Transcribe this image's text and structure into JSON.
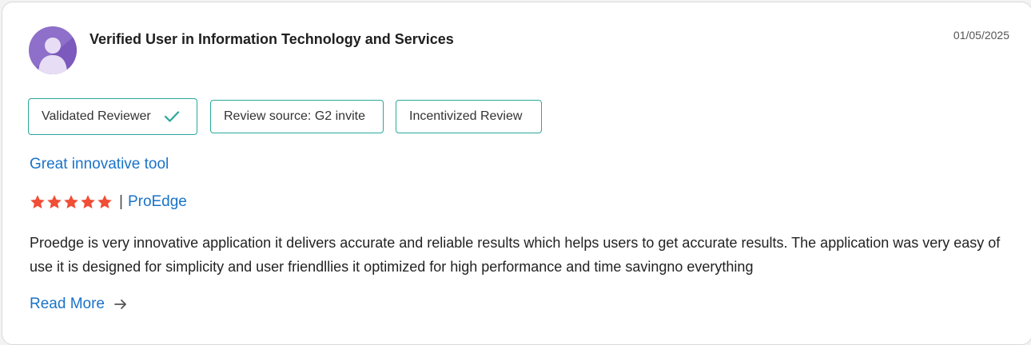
{
  "review": {
    "reviewer_name": "Verified User in Information Technology and Services",
    "date": "01/05/2025",
    "badges": [
      {
        "label": "Validated Reviewer",
        "icon": "check-icon"
      },
      {
        "label": "Review source: G2 invite"
      },
      {
        "label": "Incentivized Review"
      }
    ],
    "title": "Great innovative tool",
    "rating": 5,
    "rating_max": 5,
    "separator": "|",
    "product": "ProEdge",
    "body": "Proedge is very innovative application it delivers accurate and reliable results which helps users to get accurate results. The application was very easy of use it is designed for simplicity and user friendllies it optimized for high performance and time savingno everything",
    "read_more": "Read More"
  },
  "colors": {
    "accent_link": "#1a73c8",
    "badge_border": "#2aa89a",
    "star": "#f04e36",
    "avatar_bg": "#8e6fc9"
  },
  "icons": {
    "avatar": "user-avatar-icon",
    "star": "star-icon",
    "arrow": "arrow-right-icon"
  }
}
